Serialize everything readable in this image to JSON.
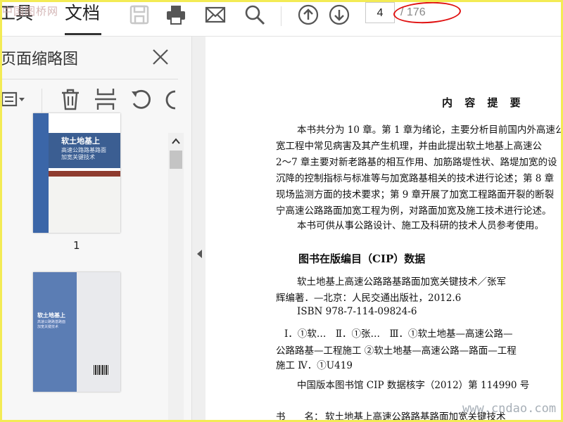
{
  "toolbar": {
    "tabs": [
      {
        "label": "工具"
      },
      {
        "label": "文档"
      }
    ],
    "watermark_text": "中国图桥网",
    "icons": [
      "save-icon",
      "print-icon",
      "mail-icon",
      "search-icon",
      "arrow-up-circle-icon",
      "arrow-down-circle-icon"
    ],
    "current_page": "4",
    "total_pages": "/ 176"
  },
  "thumbnail_panel": {
    "title": "页面缩略图",
    "tools": [
      "menu-icon",
      "delete-icon",
      "crop-icon",
      "rotate-left-icon",
      "rotate-right-icon"
    ],
    "thumbnails": [
      {
        "title": "软土地基上",
        "subtitle_lines": [
          "高速公路路基路面",
          "加宽关键技术"
        ],
        "label": "1"
      },
      {
        "title": "软土地基上",
        "subtitle_lines": [
          "高速公路路基路面",
          "加宽关键技术"
        ],
        "label": ""
      }
    ]
  },
  "document": {
    "heading": "内 容 提 要",
    "lines": [
      "本书共分为 10 章。第 1 章为绪论，主要分析目前国内外高速公",
      "宽工程中常见病害及其产生机理，并由此提出软土地基上高速公",
      "2～7 章主要对新老路基的相互作用、加筋路堤性状、路堤加宽的设",
      "沉降的控制指标与标准等与加宽路基相关的技术进行论述；第 8 章",
      "现场监测方面的技术要求；第 9 章开展了加宽工程路面开裂的断裂",
      "宁高速公路路面加宽工程为例，对路面加宽及施工技术进行论述。",
      "本书可供从事公路设计、施工及科研的技术人员参考使用。"
    ],
    "cip_heading": "图书在版编目（CIP）数据",
    "cip_lines": [
      "软土地基上高速公路路基路面加宽关键技术／张军",
      "辉编著．—北京：人民交通出版社，2012.6",
      "ISBN 978-7-114-09824-6",
      "Ⅰ．①软…　Ⅱ．①张…　Ⅲ．①软土地基—高速公路—",
      "公路路基—工程施工 ②软土地基—高速公路—路面—工程",
      "施工 Ⅳ．①U419",
      "中国版本图书馆 CIP 数据核字（2012）第 114990 号"
    ],
    "book_line_label": "书　　名：",
    "book_line_value": "软土地基上高速公路路基路面加宽关键技术"
  },
  "site_watermark": "www.cndao.com"
}
